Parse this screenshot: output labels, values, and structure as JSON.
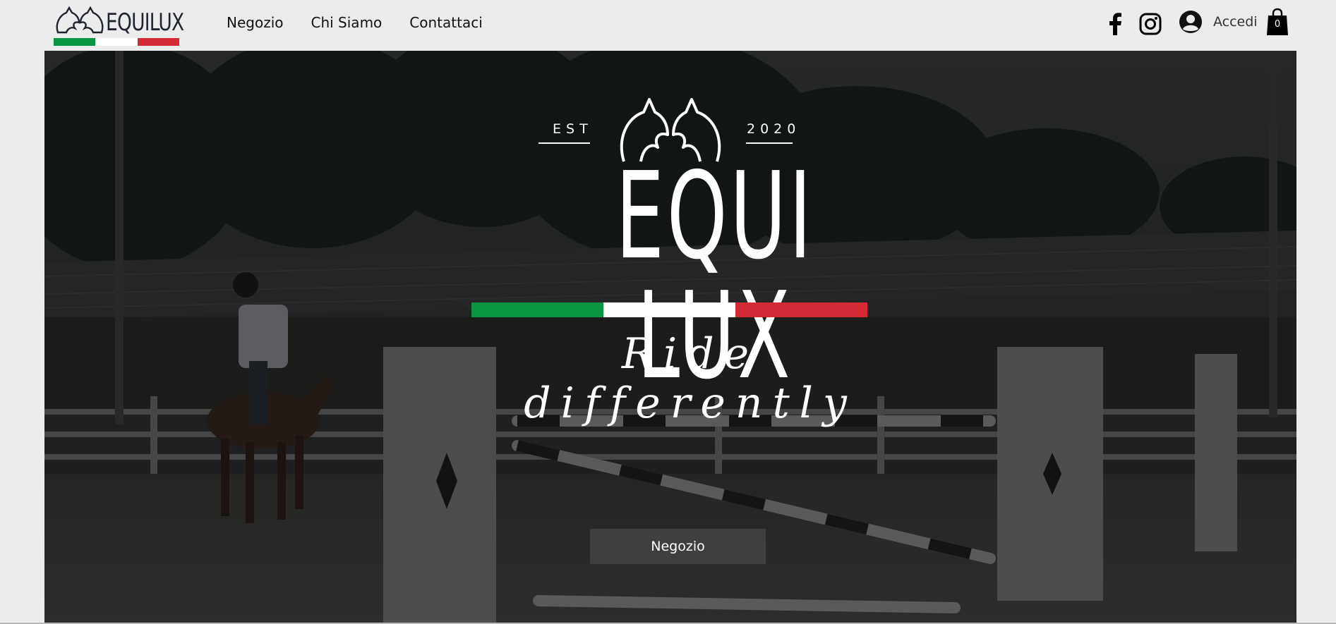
{
  "header": {
    "logo_text": "EQUILUX",
    "flag_colors": [
      "#0b9444",
      "#ffffff",
      "#d42a35"
    ],
    "nav": [
      {
        "label": "Negozio"
      },
      {
        "label": "Chi Siamo"
      },
      {
        "label": "Contattaci"
      }
    ],
    "social_icons": [
      "facebook-icon",
      "instagram-icon"
    ],
    "login_label": "Accedi",
    "cart_count": "0"
  },
  "hero": {
    "est_label": "EST",
    "year": "2020",
    "brand": "EQUI LUX",
    "tagline": "Ride differently",
    "cta_label": "Negozio"
  }
}
